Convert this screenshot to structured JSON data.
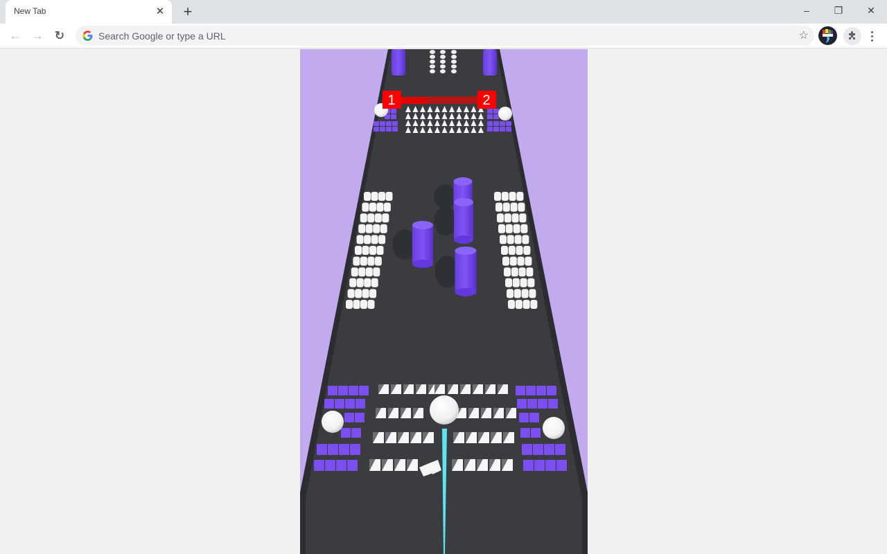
{
  "browser": {
    "tab": {
      "title": "New Tab",
      "close_icon": "close-icon"
    },
    "new_tab_icon": "plus-icon",
    "window_controls": {
      "minimize": "–",
      "restore": "❐",
      "close": "✕"
    },
    "nav": {
      "back": "←",
      "forward": "→",
      "reload": "↻"
    },
    "omnibox": {
      "placeholder": "Search Google or type a URL",
      "value": ""
    },
    "bookmark_icon": "☆"
  },
  "game": {
    "background_color": "#c2aaef",
    "road_color": "#3a3c3f",
    "accent_color": "#7b4fef",
    "gate": {
      "left_label": "1",
      "right_label": "2",
      "color": "#f00000"
    },
    "player": {
      "color": "#ffffff",
      "trail_color": "#5fe3f0"
    }
  }
}
